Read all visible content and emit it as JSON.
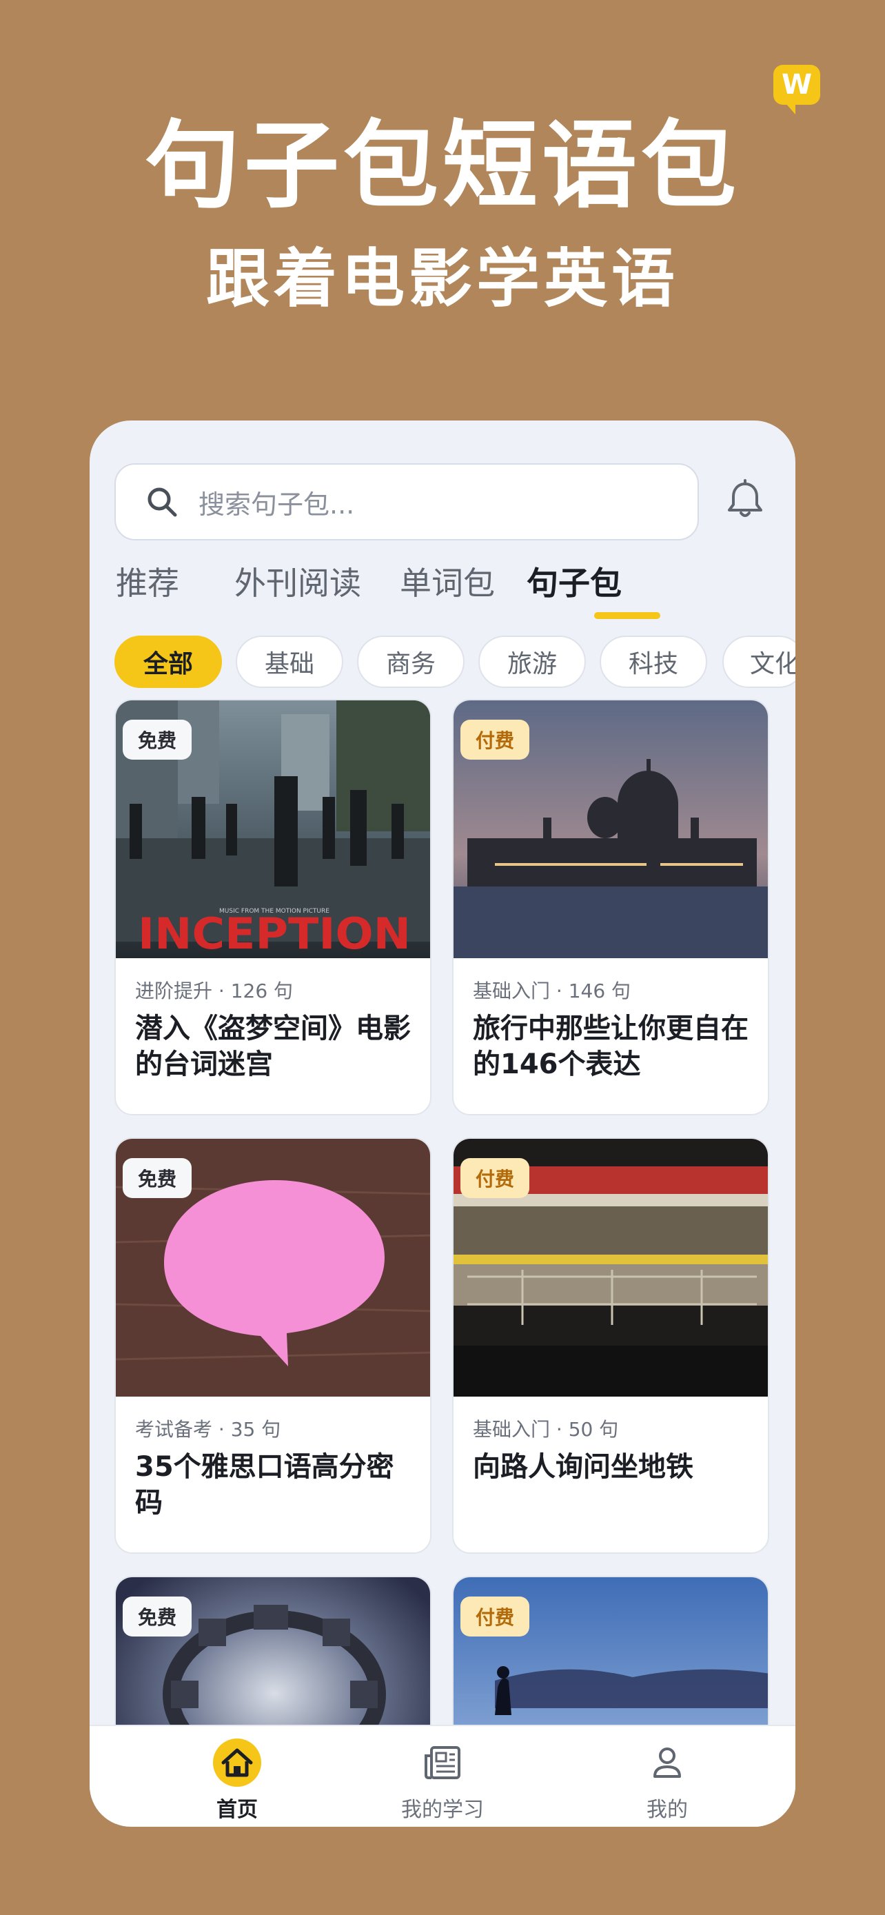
{
  "hero": {
    "title": "句子包短语包",
    "subtitle": "跟着电影学英语",
    "logo_letter": "W"
  },
  "search": {
    "placeholder": "搜索句子包..."
  },
  "tabs": [
    {
      "label": "推荐",
      "active": false
    },
    {
      "label": "外刊阅读",
      "active": false
    },
    {
      "label": "单词包",
      "active": false
    },
    {
      "label": "句子包",
      "active": true
    }
  ],
  "chips": [
    {
      "label": "全部",
      "active": true
    },
    {
      "label": "基础",
      "active": false
    },
    {
      "label": "商务",
      "active": false
    },
    {
      "label": "旅游",
      "active": false
    },
    {
      "label": "科技",
      "active": false
    },
    {
      "label": "文化",
      "active": false
    }
  ],
  "cards": [
    {
      "badge": "免费",
      "badge_type": "free",
      "meta": "进阶提升 · 126 句",
      "title": "潜入《盗梦空间》电影的台词迷宫",
      "poster_text": "INCEPTION",
      "poster_small": "MUSIC FROM THE MOTION PICTURE"
    },
    {
      "badge": "付费",
      "badge_type": "paid",
      "meta": "基础入门 · 146 句",
      "title": "旅行中那些让你更自在的146个表达"
    },
    {
      "badge": "免费",
      "badge_type": "free",
      "meta": "考试备考 · 35 句",
      "title": "35个雅思口语高分密码"
    },
    {
      "badge": "付费",
      "badge_type": "paid",
      "meta": "基础入门 · 50 句",
      "title": "向路人询问坐地铁"
    },
    {
      "badge": "免费",
      "badge_type": "free"
    },
    {
      "badge": "付费",
      "badge_type": "paid"
    }
  ],
  "bottom_nav": [
    {
      "label": "首页",
      "icon": "home-icon",
      "active": true
    },
    {
      "label": "我的学习",
      "icon": "news-icon",
      "active": false
    },
    {
      "label": "我的",
      "icon": "user-icon",
      "active": false
    }
  ],
  "colors": {
    "background": "#B0865A",
    "accent": "#F5C518",
    "paid_badge": "#FCE9B6"
  }
}
